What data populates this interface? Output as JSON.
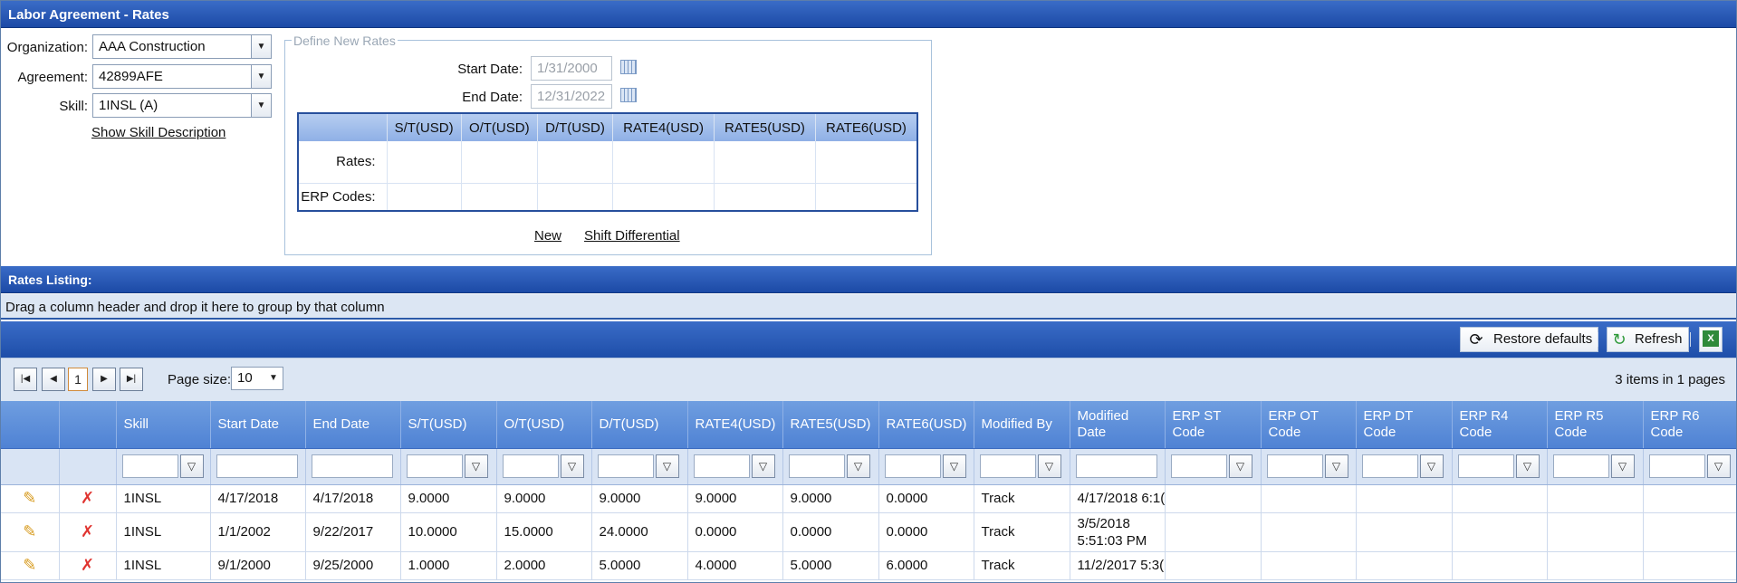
{
  "window": {
    "title": "Labor Agreement - Rates"
  },
  "form": {
    "organization": {
      "label": "Organization:",
      "value": "AAA Construction"
    },
    "agreement": {
      "label": "Agreement:",
      "value": "42899AFE"
    },
    "skill": {
      "label": "Skill:",
      "value": "1INSL (A)"
    },
    "show_skill_description": "Show Skill Description"
  },
  "define_rates": {
    "legend": "Define New Rates",
    "start_date": {
      "label": "Start Date:",
      "value": "1/31/2000"
    },
    "end_date": {
      "label": "End Date:",
      "value": "12/31/2022"
    },
    "columns": [
      "S/T(USD)",
      "O/T(USD)",
      "D/T(USD)",
      "RATE4(USD)",
      "RATE5(USD)",
      "RATE6(USD)"
    ],
    "row_labels": [
      "Rates:",
      "ERP Codes:"
    ],
    "new_link": "New",
    "shift_link": "Shift Differential"
  },
  "listing": {
    "title": "Rates Listing:",
    "group_hint": "Drag a column header and drop it here to group by that column",
    "restore_defaults": "Restore defaults",
    "refresh": "Refresh",
    "page_size_label": "Page size:",
    "page_size": "10",
    "current_page": "1",
    "items_summary": "3 items in 1 pages",
    "columns": [
      "Skill",
      "Start Date",
      "End Date",
      "S/T(USD)",
      "O/T(USD)",
      "D/T(USD)",
      "RATE4(USD)",
      "RATE5(USD)",
      "RATE6(USD)",
      "Modified By",
      "Modified Date",
      "ERP ST Code",
      "ERP OT Code",
      "ERP DT Code",
      "ERP R4 Code",
      "ERP R5 Code",
      "ERP R6 Code"
    ],
    "rows": [
      [
        "1INSL",
        "4/17/2018",
        "4/17/2018",
        "9.0000",
        "9.0000",
        "9.0000",
        "9.0000",
        "9.0000",
        "0.0000",
        "Track",
        "4/17/2018 6:1(",
        "",
        "",
        "",
        "",
        "",
        ""
      ],
      [
        "1INSL",
        "1/1/2002",
        "9/22/2017",
        "10.0000",
        "15.0000",
        "24.0000",
        "0.0000",
        "0.0000",
        "0.0000",
        "Track",
        "3/5/2018 5:51:03 PM",
        "",
        "",
        "",
        "",
        "",
        ""
      ],
      [
        "1INSL",
        "9/1/2000",
        "9/25/2000",
        "1.0000",
        "2.0000",
        "5.0000",
        "4.0000",
        "5.0000",
        "6.0000",
        "Track",
        "11/2/2017 5:3(",
        "",
        "",
        "",
        "",
        "",
        ""
      ]
    ]
  },
  "icons": {
    "edit": "pencil-icon",
    "delete": "delete-x-icon",
    "filter": "filter-icon",
    "refresh": "refresh-icon",
    "restore": "restore-icon",
    "export": "excel-export-icon",
    "calendar": "calendar-icon"
  }
}
